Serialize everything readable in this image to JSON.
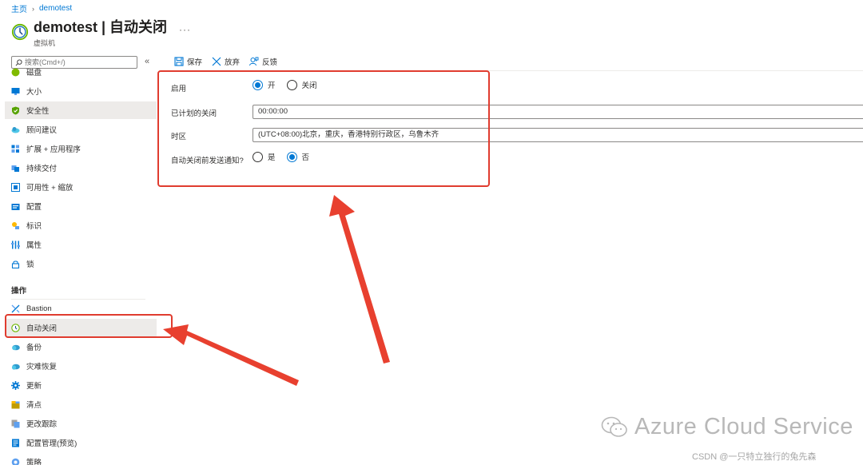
{
  "breadcrumb": {
    "home": "主页",
    "current": "demotest"
  },
  "header": {
    "title": "demotest | 自动关闭",
    "subtitle": "虚拟机",
    "more": "···"
  },
  "search": {
    "placeholder": "搜索(Cmd+/)",
    "collapse": "«"
  },
  "sidebar": {
    "items": [
      {
        "label": "磁盘",
        "icon": "disk-icon"
      },
      {
        "label": "大小",
        "icon": "monitor-icon"
      },
      {
        "label": "安全性",
        "icon": "shield-icon"
      },
      {
        "label": "顾问建议",
        "icon": "cloud-advisor-icon"
      },
      {
        "label": "扩展 + 应用程序",
        "icon": "extensions-icon"
      },
      {
        "label": "持续交付",
        "icon": "delivery-icon"
      },
      {
        "label": "可用性 + 缩放",
        "icon": "availability-icon"
      },
      {
        "label": "配置",
        "icon": "config-icon"
      },
      {
        "label": "标识",
        "icon": "identity-icon"
      },
      {
        "label": "属性",
        "icon": "properties-icon"
      },
      {
        "label": "锁",
        "icon": "lock-icon"
      }
    ],
    "section_operations": "操作",
    "ops_items": [
      {
        "label": "Bastion",
        "icon": "bastion-icon"
      },
      {
        "label": "自动关闭",
        "icon": "clock-icon"
      },
      {
        "label": "备份",
        "icon": "backup-icon"
      },
      {
        "label": "灾难恢复",
        "icon": "recovery-icon"
      },
      {
        "label": "更新",
        "icon": "gear-icon"
      },
      {
        "label": "清点",
        "icon": "inventory-icon"
      },
      {
        "label": "更改跟踪",
        "icon": "change-tracking-icon"
      },
      {
        "label": "配置管理(预览)",
        "icon": "config-management-icon"
      },
      {
        "label": "策略",
        "icon": "policy-icon"
      }
    ]
  },
  "toolbar": {
    "save": "保存",
    "discard": "放弃",
    "feedback": "反馈"
  },
  "form": {
    "enable_label": "启用",
    "enable_on": "开",
    "enable_off": "关闭",
    "enable_value": "on",
    "shutdown_label": "已计划的关闭",
    "shutdown_value": "00:00:00",
    "timezone_label": "时区",
    "timezone_value": "(UTC+08:00)北京，重庆，香港特别行政区，乌鲁木齐",
    "notify_label": "自动关闭前发送通知?",
    "notify_yes": "是",
    "notify_no": "否",
    "notify_value": "no"
  },
  "watermark": {
    "text": "Azure Cloud Service",
    "credit": "CSDN @一只特立独行的兔先森"
  },
  "colors": {
    "accent": "#0078d4",
    "highlight": "#e03c2f",
    "active_bg": "#edebe9"
  }
}
